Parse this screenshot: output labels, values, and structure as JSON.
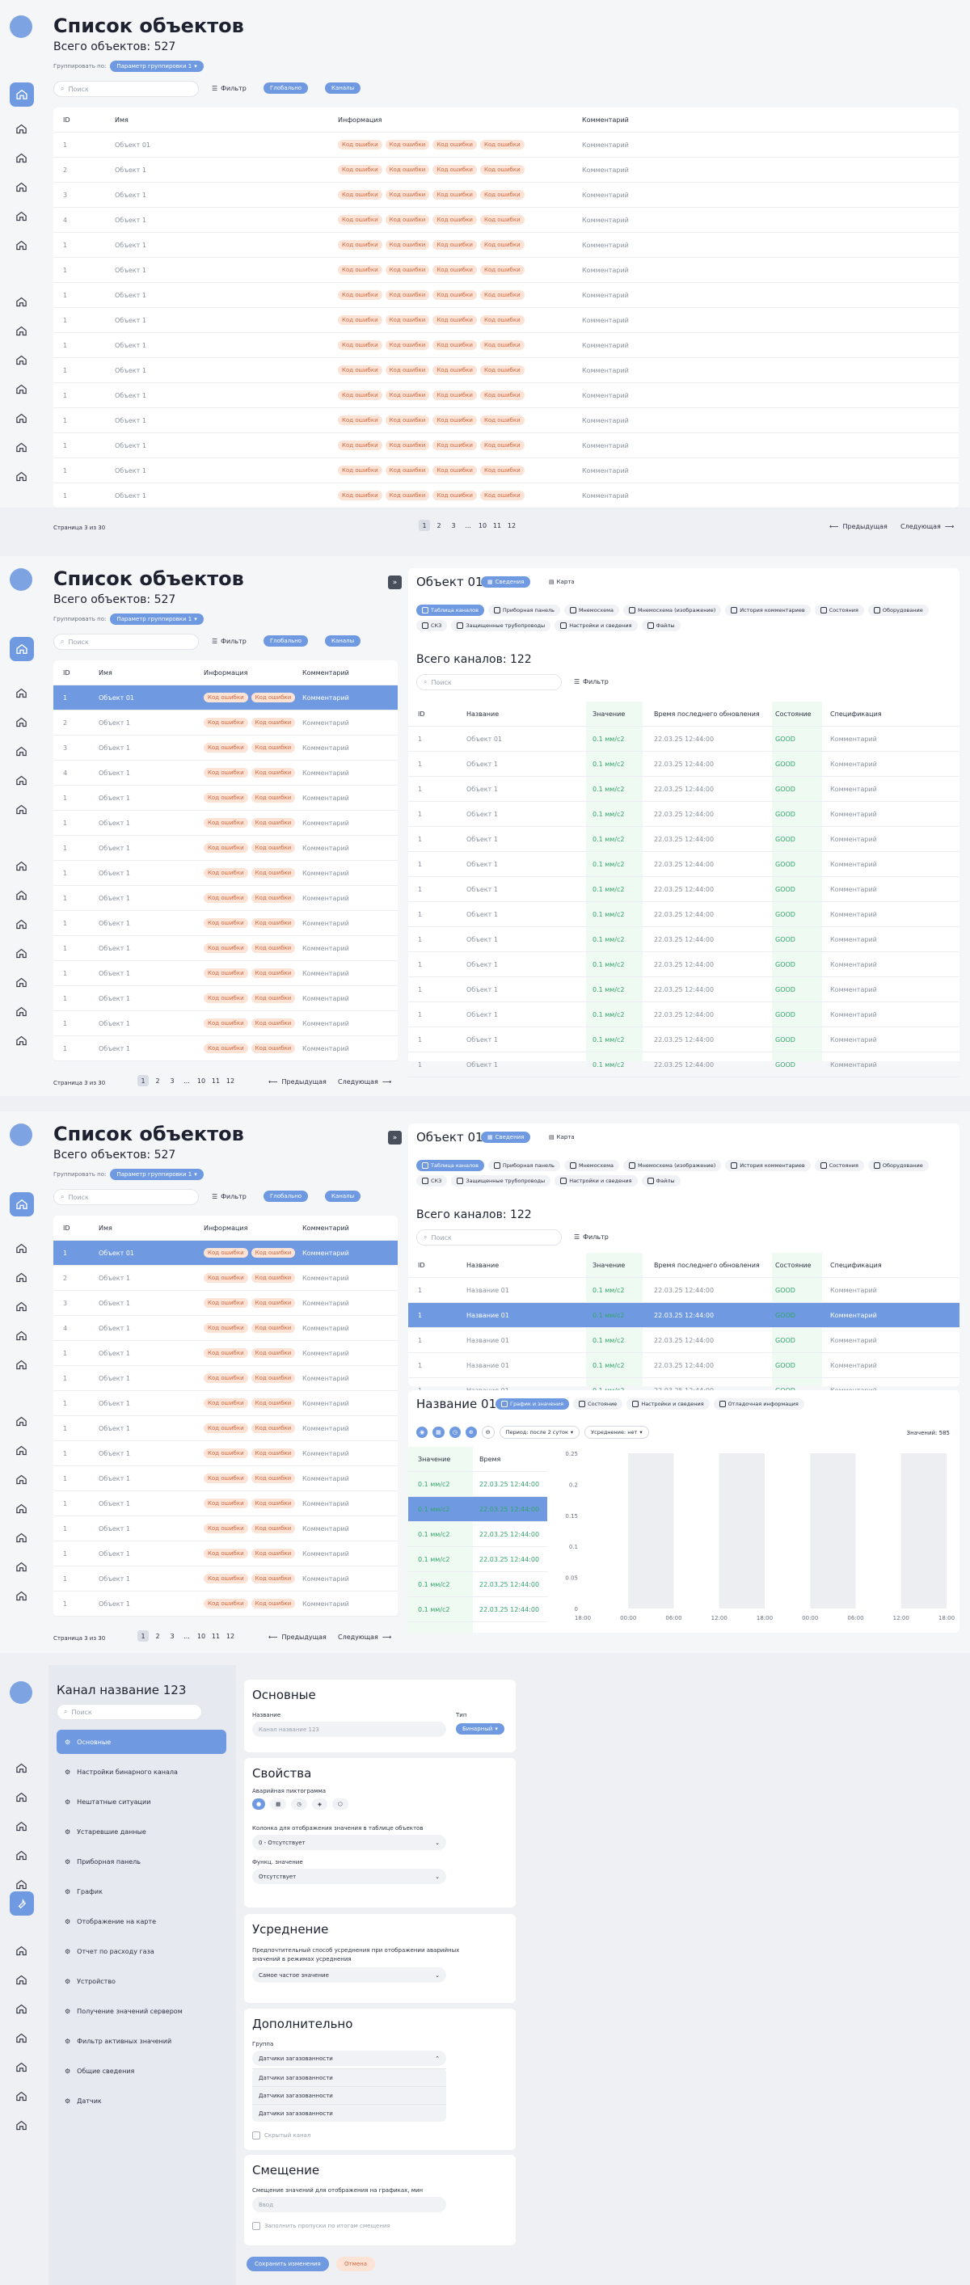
{
  "list": {
    "title": "Список объектов",
    "total": "Всего объектов: 527",
    "group_label": "Группировать по:",
    "group_value": "Параметр группировки 1",
    "search_placeholder": "Поиск",
    "filter": "Фильтр",
    "chip1": "Глобально",
    "chip2": "Каналы",
    "cols": {
      "id": "ID",
      "name": "Имя",
      "info": "Информация",
      "comment": "Комментарий"
    },
    "tag": "Код ошибки",
    "comment": "Комментарий",
    "rows": [
      {
        "id": "1",
        "name": "Объект 01"
      },
      {
        "id": "2",
        "name": "Объект 1"
      },
      {
        "id": "3",
        "name": "Объект 1"
      },
      {
        "id": "4",
        "name": "Объект 1"
      },
      {
        "id": "1",
        "name": "Объект 1"
      },
      {
        "id": "1",
        "name": "Объект 1"
      },
      {
        "id": "1",
        "name": "Объект 1"
      },
      {
        "id": "1",
        "name": "Объект 1"
      },
      {
        "id": "1",
        "name": "Объект 1"
      },
      {
        "id": "1",
        "name": "Объект 1"
      },
      {
        "id": "1",
        "name": "Объект 1"
      },
      {
        "id": "1",
        "name": "Объект 1"
      },
      {
        "id": "1",
        "name": "Объект 1"
      },
      {
        "id": "1",
        "name": "Объект 1"
      },
      {
        "id": "1",
        "name": "Объект 1"
      }
    ],
    "page_info": "Страница 3 из 30",
    "pages": [
      "1",
      "2",
      "3",
      "...",
      "10",
      "11",
      "12"
    ],
    "prev": "Предыдущая",
    "next": "Следующая"
  },
  "object": {
    "title": "Объект 01",
    "tab_info": "Сведения",
    "tab_map": "Карта",
    "subtabs": [
      "Таблица каналов",
      "Приборная панель",
      "Мнемосхема",
      "Мнемосхема (изображение)",
      "История комментариев",
      "Состояния",
      "Оборудование",
      "СКЗ",
      "Защищенные трубопроводы",
      "Настройки и сведения",
      "Файлы"
    ],
    "channels_total": "Всего каналов: 122",
    "cols": {
      "id": "ID",
      "name": "Название",
      "value": "Значение",
      "time": "Время последнего обновления",
      "state": "Состояние",
      "spec": "Спецификация"
    },
    "value": "0.1 мм/с2",
    "time": "22.03.25 12:44:00",
    "state": "GOOD",
    "spec": "Комментарий",
    "row_names_a": [
      "Объект 01",
      "Объект 1",
      "Объект 1",
      "Объект 1",
      "Объект 1",
      "Объект 1",
      "Объект 1",
      "Объект 1",
      "Объект 1",
      "Объект 1",
      "Объект 1",
      "Объект 1",
      "Объект 1",
      "Объект 1"
    ],
    "row_names_b": [
      "Название 01",
      "Название 01",
      "Название 01",
      "Название 01",
      "Название 01"
    ]
  },
  "channel": {
    "title": "Название 01",
    "tabs": [
      "График и значения",
      "Состояние",
      "Настройки и сведения",
      "Отладочная информация"
    ],
    "period": "Период: после 2 суток",
    "avg": "Усреднение: нет",
    "values_count": "Значений: 585",
    "cols": {
      "value": "Значение",
      "time": "Время"
    },
    "y_ticks": [
      "0.25",
      "0.2",
      "0.15",
      "0.1",
      "0.05",
      "0"
    ],
    "x_ticks": [
      "18:00",
      "00:00",
      "06:00",
      "12:00",
      "18:00",
      "00:00",
      "06:00",
      "12:00",
      "18:00"
    ]
  },
  "settings": {
    "title": "Канал название 123",
    "search_placeholder": "Поиск",
    "menu": [
      "Основные",
      "Настройки бинарного канала",
      "Нештатные ситуации",
      "Устаревшие данные",
      "Приборная панель",
      "График",
      "Отображение на карте",
      "Отчет по расходу газа",
      "Устройство",
      "Получение значений сервером",
      "Фильтр активных значений",
      "Общие сведения",
      "Датчик"
    ],
    "basic": {
      "title": "Основные",
      "name_label": "Название",
      "name_placeholder": "Канал название 123",
      "type_label": "Тип",
      "type_value": "Бинарный"
    },
    "props": {
      "title": "Свойства",
      "alarm_label": "Аварийная пиктограмма",
      "col_label": "Колонка для отображения значения в таблице объектов",
      "col_value": "0 - Отсутствует",
      "func_label": "Функц. значение",
      "func_value": "Отсутствует"
    },
    "avg": {
      "title": "Усреднение",
      "label": "Предпочтительный способ усреднения при отображении аварийных значений в режимах усреднения",
      "value": "Самое частое значение"
    },
    "extra": {
      "title": "Дополнительно",
      "group_label": "Группа",
      "group_value": "Датчики загазованности",
      "options": [
        "Датчики загазованности",
        "Датчики загазованности",
        "Датчики загазованности"
      ],
      "hidden": "Скрытый канал"
    },
    "shift": {
      "title": "Смещение",
      "label": "Смещение значений для отображения на графиках, мин",
      "placeholder": "Ввод",
      "fill": "Заполнить пропуски по итогам смещения"
    },
    "save": "Сохранить изменения",
    "cancel": "Отмена"
  }
}
